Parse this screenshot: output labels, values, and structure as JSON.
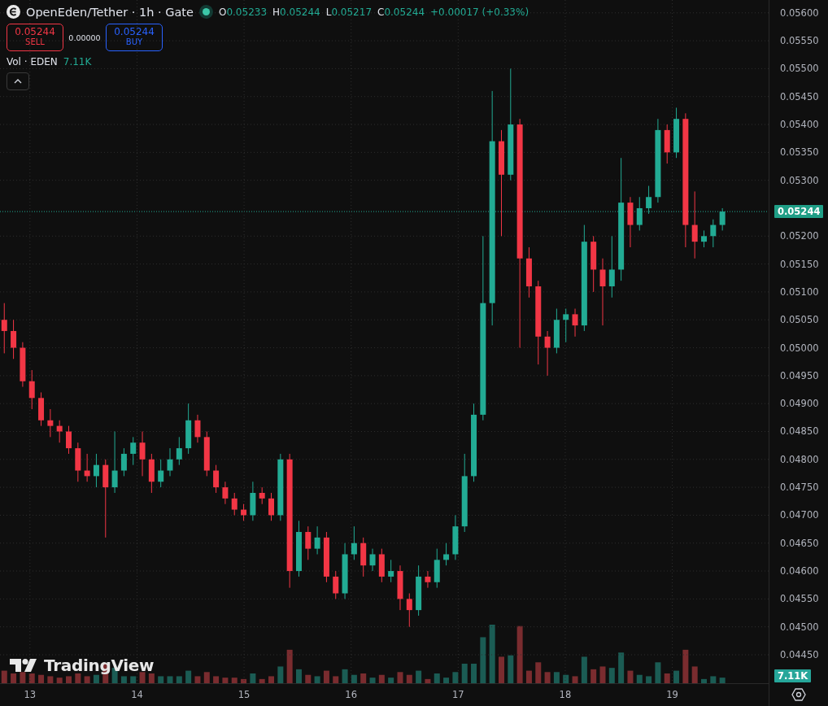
{
  "header": {
    "symbol": "OpenEden/Tether · 1h · Gate",
    "ohlc": [
      {
        "key": "O",
        "value": "0.05233"
      },
      {
        "key": "H",
        "value": "0.05244"
      },
      {
        "key": "L",
        "value": "0.05217"
      },
      {
        "key": "C",
        "value": "0.05244"
      }
    ],
    "change": "+0.00017 (+0.33%)"
  },
  "trade": {
    "sell_price": "0.05244",
    "sell_label": "SELL",
    "spread": "0.00000",
    "buy_price": "0.05244",
    "buy_label": "BUY"
  },
  "volume_legend": {
    "label": "Vol · EDEN",
    "value": "7.11K"
  },
  "chart": {
    "chart_data": {
      "type": "candlestick",
      "ylim": [
        0.04399,
        0.05623
      ],
      "xlim": [
        12.72,
        19.9
      ],
      "x": [
        12.76,
        12.846,
        12.932,
        13.018,
        13.104,
        13.19,
        13.276,
        13.362,
        13.448,
        13.534,
        13.62,
        13.706,
        13.792,
        13.878,
        13.964,
        14.05,
        14.136,
        14.222,
        14.308,
        14.394,
        14.48,
        14.566,
        14.652,
        14.738,
        14.824,
        14.91,
        14.996,
        15.082,
        15.168,
        15.254,
        15.34,
        15.426,
        15.512,
        15.598,
        15.684,
        15.77,
        15.856,
        15.942,
        16.028,
        16.114,
        16.2,
        16.286,
        16.372,
        16.458,
        16.544,
        16.63,
        16.716,
        16.802,
        16.888,
        16.974,
        17.06,
        17.146,
        17.232,
        17.318,
        17.404,
        17.49,
        17.576,
        17.662,
        17.748,
        17.834,
        17.92,
        18.006,
        18.092,
        18.178,
        18.264,
        18.35,
        18.436,
        18.522,
        18.608,
        18.694,
        18.78,
        18.866,
        18.952,
        19.038,
        19.124,
        19.21,
        19.296,
        19.382,
        19.468
      ],
      "ohlc": [
        [
          0.0505,
          0.0508,
          0.0499,
          0.0503
        ],
        [
          0.0503,
          0.0505,
          0.0498,
          0.05
        ],
        [
          0.05,
          0.0501,
          0.0493,
          0.0494
        ],
        [
          0.0494,
          0.0496,
          0.0489,
          0.0491
        ],
        [
          0.0491,
          0.0492,
          0.0486,
          0.0487
        ],
        [
          0.0487,
          0.0489,
          0.0484,
          0.0486
        ],
        [
          0.0486,
          0.0487,
          0.0483,
          0.0485
        ],
        [
          0.0485,
          0.0486,
          0.0481,
          0.0482
        ],
        [
          0.0482,
          0.0483,
          0.0476,
          0.0478
        ],
        [
          0.0478,
          0.0481,
          0.0476,
          0.0477
        ],
        [
          0.0477,
          0.0481,
          0.0475,
          0.0479
        ],
        [
          0.0479,
          0.048,
          0.0466,
          0.0475
        ],
        [
          0.0475,
          0.0485,
          0.0474,
          0.0478
        ],
        [
          0.0478,
          0.0482,
          0.0477,
          0.0481
        ],
        [
          0.0481,
          0.0484,
          0.0479,
          0.0483
        ],
        [
          0.0483,
          0.0485,
          0.0477,
          0.048
        ],
        [
          0.048,
          0.0481,
          0.0474,
          0.0476
        ],
        [
          0.0476,
          0.048,
          0.0475,
          0.0478
        ],
        [
          0.0478,
          0.0482,
          0.0477,
          0.048
        ],
        [
          0.048,
          0.0484,
          0.0479,
          0.0482
        ],
        [
          0.0482,
          0.049,
          0.0481,
          0.0487
        ],
        [
          0.0487,
          0.0488,
          0.0483,
          0.0484
        ],
        [
          0.0484,
          0.0485,
          0.0477,
          0.0478
        ],
        [
          0.0478,
          0.0479,
          0.0474,
          0.0475
        ],
        [
          0.0475,
          0.0476,
          0.0472,
          0.0473
        ],
        [
          0.0473,
          0.0474,
          0.047,
          0.0471
        ],
        [
          0.0471,
          0.0472,
          0.0469,
          0.047
        ],
        [
          0.047,
          0.0476,
          0.0469,
          0.0474
        ],
        [
          0.0474,
          0.0475,
          0.0472,
          0.0473
        ],
        [
          0.0473,
          0.0474,
          0.0469,
          0.047
        ],
        [
          0.047,
          0.0481,
          0.0469,
          0.048
        ],
        [
          0.048,
          0.0481,
          0.0457,
          0.046
        ],
        [
          0.046,
          0.0469,
          0.0459,
          0.0467
        ],
        [
          0.0467,
          0.0468,
          0.0462,
          0.0464
        ],
        [
          0.0464,
          0.0468,
          0.0463,
          0.0466
        ],
        [
          0.0466,
          0.0467,
          0.0458,
          0.0459
        ],
        [
          0.0459,
          0.046,
          0.0455,
          0.0456
        ],
        [
          0.0456,
          0.0465,
          0.0455,
          0.0463
        ],
        [
          0.0463,
          0.0468,
          0.0462,
          0.0465
        ],
        [
          0.0465,
          0.0466,
          0.0459,
          0.0461
        ],
        [
          0.0461,
          0.0464,
          0.046,
          0.0463
        ],
        [
          0.0463,
          0.0464,
          0.0458,
          0.0459
        ],
        [
          0.0459,
          0.0462,
          0.0458,
          0.046
        ],
        [
          0.046,
          0.0461,
          0.0453,
          0.0455
        ],
        [
          0.0455,
          0.0456,
          0.045,
          0.0453
        ],
        [
          0.0453,
          0.0461,
          0.0452,
          0.0459
        ],
        [
          0.0459,
          0.046,
          0.0457,
          0.0458
        ],
        [
          0.0458,
          0.0464,
          0.0457,
          0.0462
        ],
        [
          0.0462,
          0.0465,
          0.0461,
          0.0463
        ],
        [
          0.0463,
          0.047,
          0.0462,
          0.0468
        ],
        [
          0.0468,
          0.0481,
          0.0467,
          0.0477
        ],
        [
          0.0477,
          0.049,
          0.0476,
          0.0488
        ],
        [
          0.0488,
          0.052,
          0.0487,
          0.0508
        ],
        [
          0.0508,
          0.0546,
          0.0504,
          0.0537
        ],
        [
          0.0537,
          0.0539,
          0.052,
          0.0531
        ],
        [
          0.0531,
          0.055,
          0.053,
          0.054
        ],
        [
          0.054,
          0.0541,
          0.05,
          0.0516
        ],
        [
          0.0516,
          0.0518,
          0.0509,
          0.0511
        ],
        [
          0.0511,
          0.0512,
          0.0497,
          0.0502
        ],
        [
          0.0502,
          0.0503,
          0.0495,
          0.05
        ],
        [
          0.05,
          0.0507,
          0.0499,
          0.0505
        ],
        [
          0.0505,
          0.0507,
          0.0501,
          0.0506
        ],
        [
          0.0506,
          0.0507,
          0.0502,
          0.0504
        ],
        [
          0.0504,
          0.0522,
          0.0503,
          0.0519
        ],
        [
          0.0519,
          0.052,
          0.051,
          0.0514
        ],
        [
          0.0514,
          0.0516,
          0.0504,
          0.0511
        ],
        [
          0.0511,
          0.052,
          0.0509,
          0.0514
        ],
        [
          0.0514,
          0.0534,
          0.0512,
          0.0526
        ],
        [
          0.0526,
          0.0527,
          0.0518,
          0.0522
        ],
        [
          0.0522,
          0.0527,
          0.0521,
          0.0525
        ],
        [
          0.0525,
          0.0529,
          0.0524,
          0.0527
        ],
        [
          0.0527,
          0.0541,
          0.0526,
          0.0539
        ],
        [
          0.0539,
          0.054,
          0.0533,
          0.0535
        ],
        [
          0.0535,
          0.0543,
          0.0534,
          0.0541
        ],
        [
          0.0541,
          0.0542,
          0.0518,
          0.0522
        ],
        [
          0.0522,
          0.0528,
          0.0516,
          0.0519
        ],
        [
          0.0519,
          0.0521,
          0.0518,
          0.052
        ],
        [
          0.052,
          0.0523,
          0.0518,
          0.0522
        ],
        [
          0.0522,
          0.0525,
          0.0521,
          0.05244
        ]
      ],
      "xticks": [
        13,
        14,
        15,
        16,
        17,
        18,
        19
      ],
      "grid": true,
      "yticks": [
        {
          "value": 0.056,
          "label": "0.05600"
        },
        {
          "value": 0.0555,
          "label": "0.05550"
        },
        {
          "value": 0.055,
          "label": "0.05500"
        },
        {
          "value": 0.0545,
          "label": "0.05450"
        },
        {
          "value": 0.054,
          "label": "0.05400"
        },
        {
          "value": 0.0535,
          "label": "0.05350"
        },
        {
          "value": 0.053,
          "label": "0.05300"
        },
        {
          "value": 0.052,
          "label": "0.05200"
        },
        {
          "value": 0.0515,
          "label": "0.05150"
        },
        {
          "value": 0.051,
          "label": "0.05100"
        },
        {
          "value": 0.0505,
          "label": "0.05050"
        },
        {
          "value": 0.05,
          "label": "0.05000"
        },
        {
          "value": 0.0495,
          "label": "0.04950"
        },
        {
          "value": 0.049,
          "label": "0.04900"
        },
        {
          "value": 0.0485,
          "label": "0.04850"
        },
        {
          "value": 0.048,
          "label": "0.04800"
        },
        {
          "value": 0.0475,
          "label": "0.04750"
        },
        {
          "value": 0.047,
          "label": "0.04700"
        },
        {
          "value": 0.0465,
          "label": "0.04650"
        },
        {
          "value": 0.046,
          "label": "0.04600"
        },
        {
          "value": 0.0455,
          "label": "0.04550"
        },
        {
          "value": 0.045,
          "label": "0.04500"
        },
        {
          "value": 0.0445,
          "label": "0.04450"
        }
      ]
    }
  },
  "price_axis": {
    "last_price": "0.05244",
    "volume_badge": "7.11K"
  },
  "branding": "TradingView"
}
